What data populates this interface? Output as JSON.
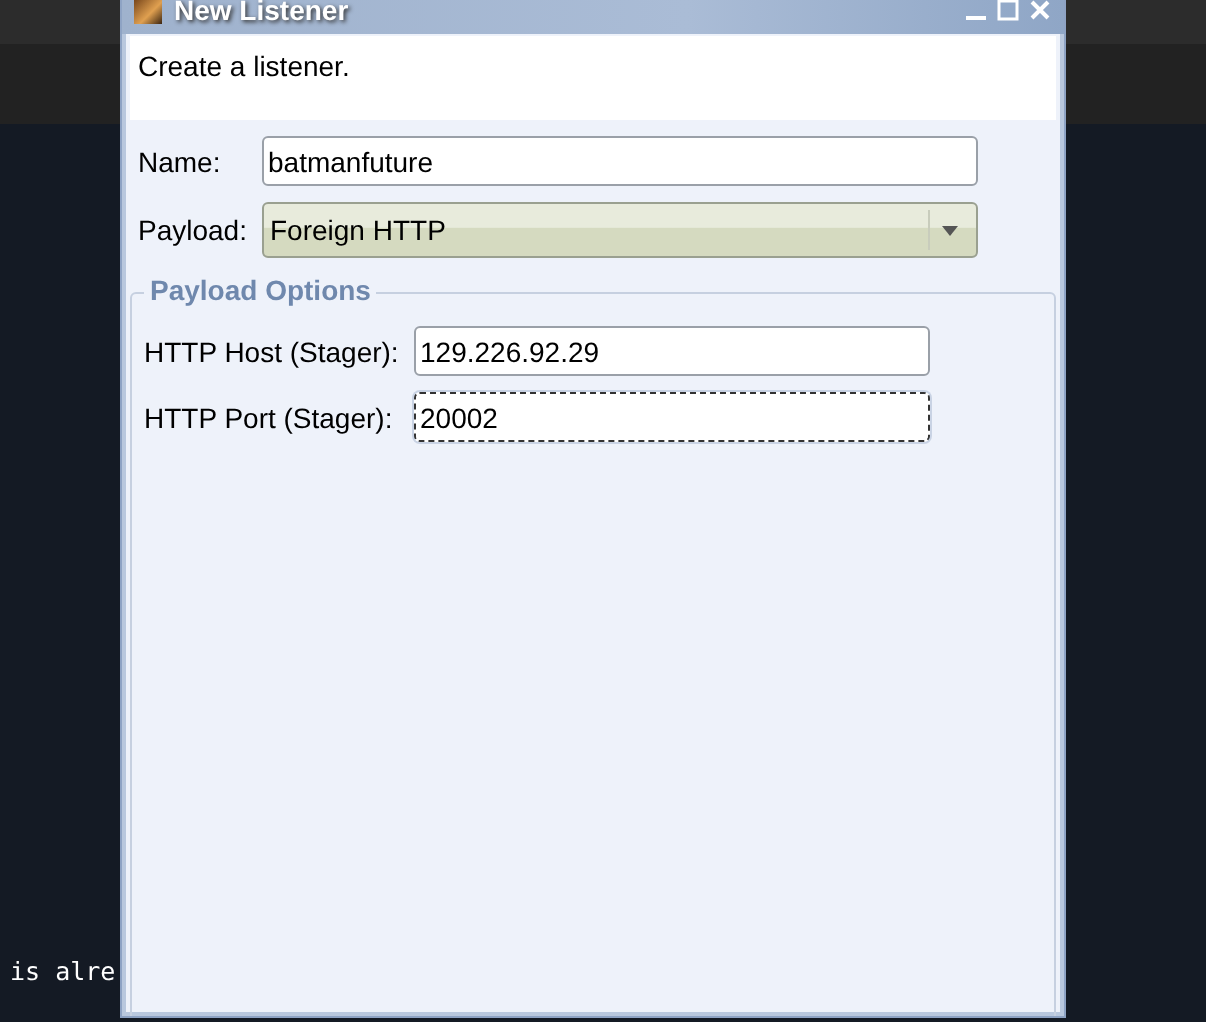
{
  "terminal": {
    "text": "is alre"
  },
  "window": {
    "title": "New Listener",
    "description": "Create a listener.",
    "name_field": {
      "label": "Name:",
      "value": "batmanfuture"
    },
    "payload": {
      "label": "Payload:",
      "value": "Foreign HTTP"
    },
    "options": {
      "title": "Payload Options",
      "fields": [
        {
          "label": "HTTP Host (Stager):",
          "value": "129.226.92.29",
          "focused": false
        },
        {
          "label": "HTTP Port (Stager):",
          "value": "20002",
          "focused": true
        }
      ]
    }
  }
}
